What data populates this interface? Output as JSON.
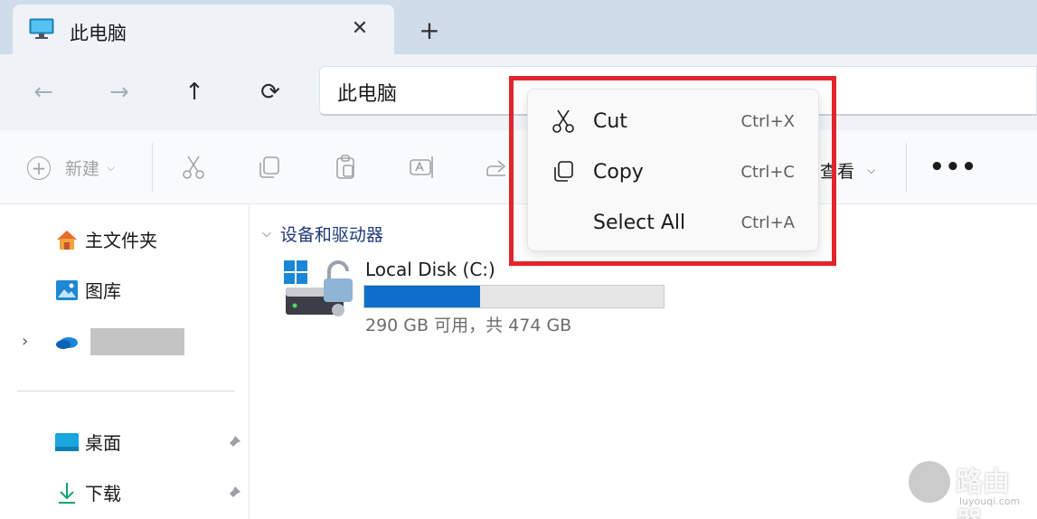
{
  "tab": {
    "title": "此电脑",
    "close": "✕",
    "new_tab": "+"
  },
  "nav": {
    "back": "←",
    "forward": "→",
    "up": "↑",
    "refresh": "⟳"
  },
  "address": {
    "text": "此电脑"
  },
  "command_bar": {
    "new_label": "新建",
    "view_label": "查看",
    "more": "•••",
    "icons": [
      "cut-icon",
      "copy-icon",
      "paste-icon",
      "rename-icon",
      "share-icon"
    ]
  },
  "sidebar": {
    "items": [
      {
        "label": "主文件夹",
        "icon": "home-icon"
      },
      {
        "label": "图库",
        "icon": "gallery-icon"
      },
      {
        "label": "",
        "icon": "onedrive-icon"
      },
      {
        "label": "桌面",
        "icon": "desktop-icon"
      },
      {
        "label": "下载",
        "icon": "download-icon"
      }
    ]
  },
  "content": {
    "group_title": "设备和驱动器",
    "drive": {
      "name": "Local Disk (C:)",
      "space_text": "290 GB 可用，共 474 GB",
      "used_fraction": 0.388
    }
  },
  "context_menu": {
    "items": [
      {
        "label": "Cut",
        "shortcut": "Ctrl+X",
        "icon": "scissors-icon"
      },
      {
        "label": "Copy",
        "shortcut": "Ctrl+C",
        "icon": "copy-icon"
      },
      {
        "label": "Select All",
        "shortcut": "Ctrl+A",
        "icon": ""
      }
    ]
  },
  "watermark": {
    "text": "路由器",
    "sub": "luyouqi.com"
  },
  "colors": {
    "accent": "#0f6ec7",
    "highlight": "#e3242b",
    "tabstrip": "#cfdcea"
  }
}
